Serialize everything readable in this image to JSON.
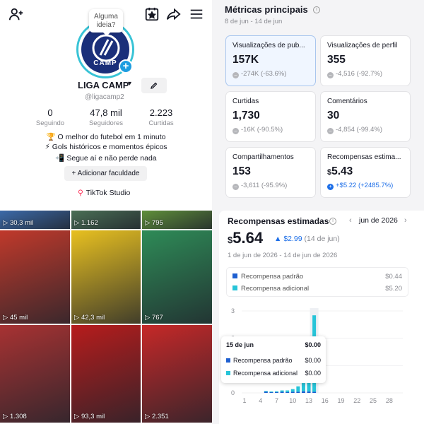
{
  "profile": {
    "bubble_text": "Alguma ideia?",
    "avatar_text": "CAMP",
    "username": "LIGA CAMP",
    "handle": "@ligacamp2",
    "stats": [
      {
        "value": "0",
        "label": "Seguindo"
      },
      {
        "value": "47,8 mil",
        "label": "Seguidores"
      },
      {
        "value": "2.223",
        "label": "Curtidas"
      }
    ],
    "bio": [
      "🏆 O melhor do futebol em 1 minuto",
      "⚡ Gols históricos e momentos épicos",
      "📲 Segue aí e não perde nada"
    ],
    "add_button": "Adicionar faculdade",
    "studio_label": "TikTok Studio"
  },
  "videos": [
    {
      "views": "30,3 mil",
      "color": "#3c6aa8"
    },
    {
      "views": "1.162",
      "color": "#4a6f55"
    },
    {
      "views": "795",
      "color": "#5f8f3a"
    },
    {
      "views": "45 mil",
      "color": "#c0392b"
    },
    {
      "views": "42,3 mil",
      "color": "#e8c020"
    },
    {
      "views": "767",
      "color": "#2e8b57"
    },
    {
      "views": "1.308",
      "color": "#a83232"
    },
    {
      "views": "93,3 mil",
      "color": "#b71c1c"
    },
    {
      "views": "2.351",
      "color": "#c62828"
    }
  ],
  "metrics": {
    "title": "Métricas principais",
    "range": "8 de jun - 14 de jun",
    "cards": [
      {
        "title": "Visualizações de pub...",
        "value": "157K",
        "delta": "-274K (-63.6%)",
        "selected": true
      },
      {
        "title": "Visualizações de perfil",
        "value": "355",
        "delta": "-4,516 (-92.7%)"
      },
      {
        "title": "Curtidas",
        "value": "1,730",
        "delta": "-16K (-90.5%)"
      },
      {
        "title": "Comentários",
        "value": "30",
        "delta": "-4,854 (-99.4%)"
      },
      {
        "title": "Compartilhamentos",
        "value": "153",
        "delta": "-3,611 (-95.9%)"
      },
      {
        "title": "Recompensas estima...",
        "currency": "$",
        "value": "5.43",
        "delta": "+$5.22 (+2485.7%)",
        "positive": true
      }
    ]
  },
  "rewards": {
    "title": "Recompensas estimadas",
    "month": "jun de 2026",
    "currency": "$",
    "total": "5.64",
    "delta": "$2.99",
    "delta_period": "(14 de jun)",
    "range": "1 de jun de 2026 - 14 de jun de 2026",
    "legend": [
      {
        "label": "Recompensa padrão",
        "value": "$0.44",
        "color": "#1e5fd0"
      },
      {
        "label": "Recompensa adicional",
        "value": "$5.20",
        "color": "#27c4d8"
      }
    ],
    "tooltip": {
      "date": "15 de jun",
      "total": "$0.00",
      "rows": [
        {
          "label": "Recompensa padrão",
          "value": "$0.00",
          "color": "#1e5fd0"
        },
        {
          "label": "Recompensa adicional",
          "value": "$0.00",
          "color": "#27c4d8"
        }
      ]
    }
  },
  "chart_data": {
    "type": "bar",
    "stacked": true,
    "x": [
      1,
      2,
      3,
      4,
      5,
      6,
      7,
      8,
      9,
      10,
      11,
      12,
      13,
      14,
      15,
      16,
      17,
      18,
      19,
      20,
      21,
      22,
      23,
      24,
      25,
      26,
      27,
      28,
      29,
      30
    ],
    "xticks": [
      "1",
      "4",
      "7",
      "10",
      "13",
      "16",
      "19",
      "22",
      "25",
      "28"
    ],
    "yticks": [
      "0",
      "1",
      "2",
      "3"
    ],
    "ylim": [
      0,
      3
    ],
    "series": [
      {
        "name": "Recompensa padrão",
        "color": "#1e5fd0",
        "values": [
          0,
          0,
          0,
          0,
          0.05,
          0.03,
          0.03,
          0.04,
          0.03,
          0.04,
          0.04,
          0.06,
          0.05,
          0.04,
          0,
          0,
          0,
          0,
          0,
          0,
          0,
          0,
          0,
          0,
          0,
          0,
          0,
          0,
          0,
          0
        ]
      },
      {
        "name": "Recompensa adicional",
        "color": "#27c4d8",
        "values": [
          0,
          0,
          0,
          0,
          0.02,
          0.02,
          0.03,
          0.05,
          0.06,
          0.1,
          0.2,
          0.3,
          0.55,
          2.8,
          0,
          0,
          0,
          0,
          0,
          0,
          0,
          0,
          0,
          0,
          0,
          0,
          0,
          0,
          0,
          0
        ]
      }
    ]
  }
}
